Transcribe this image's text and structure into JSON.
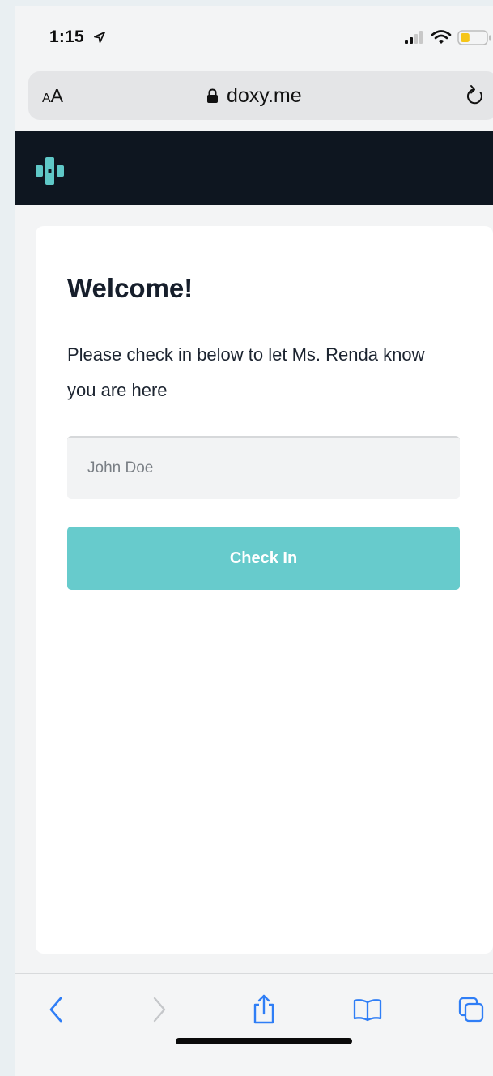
{
  "status_bar": {
    "time": "1:15",
    "icons": [
      "location-arrow-icon",
      "cellular-signal-icon",
      "wifi-icon",
      "battery-low-icon"
    ]
  },
  "address_bar": {
    "text_size_label_small": "A",
    "text_size_label_large": "A",
    "domain": "doxy.me",
    "icons": [
      "lock-icon",
      "reload-icon"
    ]
  },
  "site_header": {
    "logo_icon": "doxy-logo-icon"
  },
  "checkin_card": {
    "title": "Welcome!",
    "message": "Please check in below to let Ms. Renda know you are here",
    "name_input": {
      "value": "",
      "placeholder": "John Doe"
    },
    "checkin_button_label": "Check In"
  },
  "toolbar": {
    "items": [
      {
        "name": "back",
        "icon": "chevron-left-icon",
        "enabled": true
      },
      {
        "name": "forward",
        "icon": "chevron-right-icon",
        "enabled": false
      },
      {
        "name": "share",
        "icon": "share-icon",
        "enabled": true
      },
      {
        "name": "bookmarks",
        "icon": "book-icon",
        "enabled": true
      },
      {
        "name": "tabs",
        "icon": "tabs-icon",
        "enabled": true
      }
    ]
  },
  "colors": {
    "accent": "#67cbcc",
    "ios_blue": "#2f7ef6",
    "header_bg": "#0e1620",
    "battery_level": "#f5c518",
    "page_bg": "#f3f4f5"
  },
  "battery_level_fraction": 0.35
}
